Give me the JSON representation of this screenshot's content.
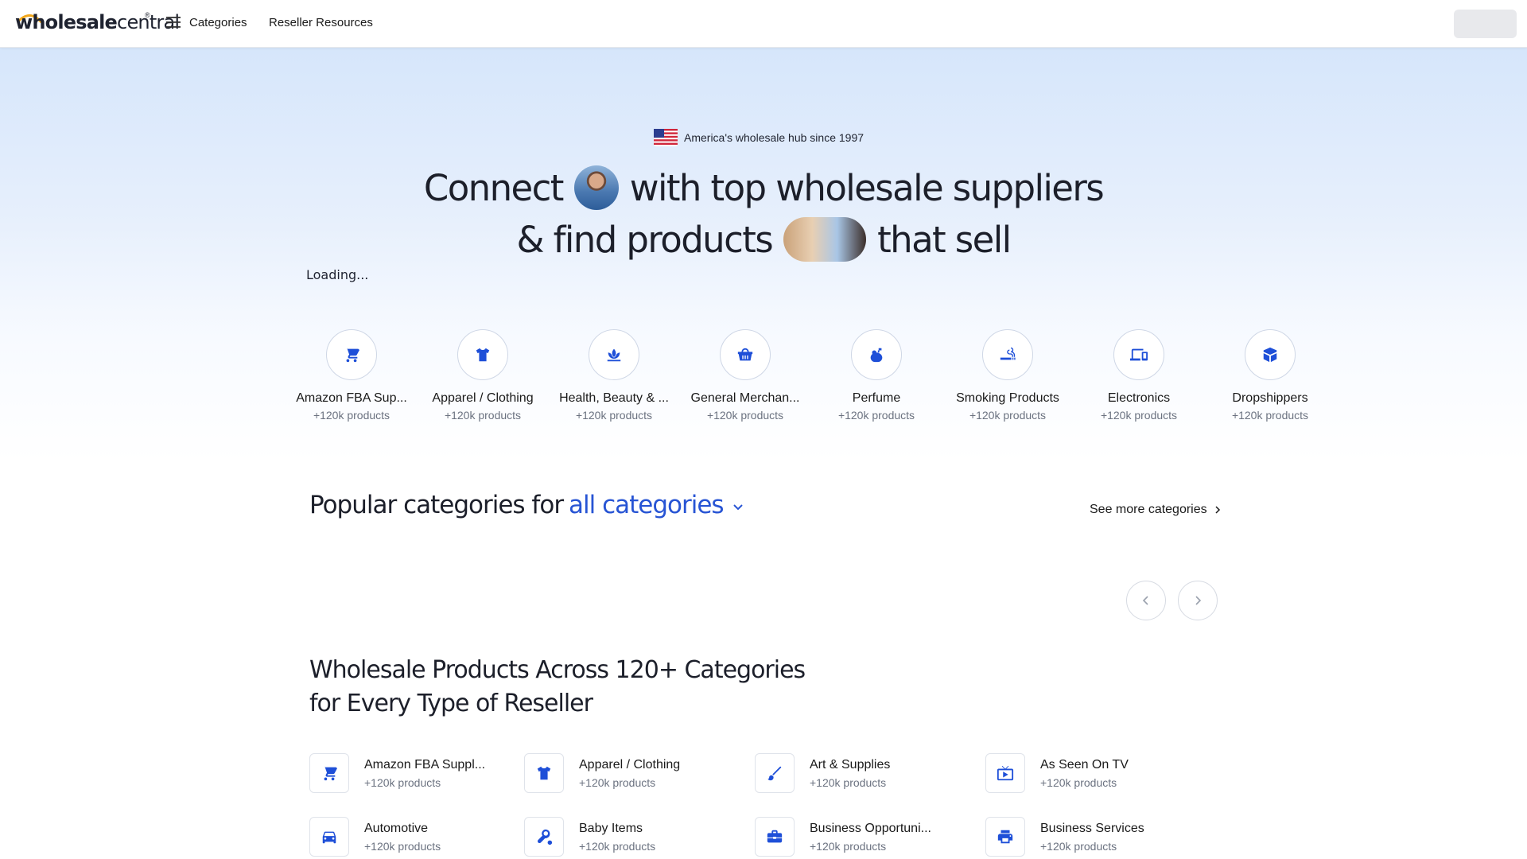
{
  "header": {
    "logo_part1": "wholesale",
    "logo_part2": "central",
    "logo_reg": "®",
    "nav": [
      {
        "label": "Categories"
      },
      {
        "label": "Reseller Resources"
      }
    ]
  },
  "hero": {
    "badge": "America's wholesale hub since 1997",
    "headline_line1_a": "Connect",
    "headline_line1_b": "with top wholesale suppliers",
    "headline_line2_a": "&  find products",
    "headline_line2_b": "that sell",
    "loading": "Loading..."
  },
  "top_categories": [
    {
      "name": "Amazon FBA Sup...",
      "count": "+120k products",
      "icon": "cart-icon"
    },
    {
      "name": "Apparel / Clothing",
      "count": "+120k products",
      "icon": "shirt-icon"
    },
    {
      "name": "Health, Beauty & ...",
      "count": "+120k products",
      "icon": "lotus-icon"
    },
    {
      "name": "General Merchan...",
      "count": "+120k products",
      "icon": "basket-icon"
    },
    {
      "name": "Perfume",
      "count": "+120k products",
      "icon": "perfume-icon"
    },
    {
      "name": "Smoking Products",
      "count": "+120k products",
      "icon": "smoking-icon"
    },
    {
      "name": "Electronics",
      "count": "+120k products",
      "icon": "devices-icon"
    },
    {
      "name": "Dropshippers",
      "count": "+120k products",
      "icon": "box-icon"
    }
  ],
  "popular": {
    "title": "Popular categories for",
    "selected": "all categories",
    "see_more": "See more categories"
  },
  "section": {
    "title": "Wholesale Products Across 120+ Categories for Every Type of Reseller"
  },
  "grid_categories": [
    {
      "name": "Amazon FBA Suppl...",
      "count": "+120k products",
      "icon": "cart-icon"
    },
    {
      "name": "Apparel / Clothing",
      "count": "+120k products",
      "icon": "shirt-icon"
    },
    {
      "name": "Art & Supplies",
      "count": "+120k products",
      "icon": "brush-icon"
    },
    {
      "name": "As Seen On TV",
      "count": "+120k products",
      "icon": "tv-icon"
    },
    {
      "name": "Automotive",
      "count": "+120k products",
      "icon": "car-icon"
    },
    {
      "name": "Baby Items",
      "count": "+120k products",
      "icon": "baby-icon"
    },
    {
      "name": "Business Opportuni...",
      "count": "+120k products",
      "icon": "briefcase-icon"
    },
    {
      "name": "Business Services",
      "count": "+120k products",
      "icon": "printer-icon"
    }
  ],
  "colors": {
    "accent": "#2754d4",
    "icon_blue": "#1e4fd8",
    "muted": "#6b7280"
  }
}
